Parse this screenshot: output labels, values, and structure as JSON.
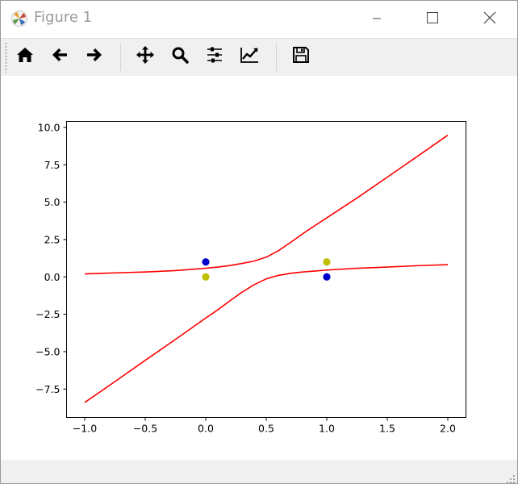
{
  "window": {
    "title": "Figure 1"
  },
  "toolbar": {
    "buttons": [
      {
        "name": "home-button",
        "icon": "home-icon"
      },
      {
        "name": "back-button",
        "icon": "arrow-left-icon"
      },
      {
        "name": "forward-button",
        "icon": "arrow-right-icon"
      },
      {
        "name": "pan-button",
        "icon": "move-icon"
      },
      {
        "name": "zoom-button",
        "icon": "magnifier-icon"
      },
      {
        "name": "subplots-button",
        "icon": "sliders-icon"
      },
      {
        "name": "axes-edit-button",
        "icon": "line-chart-icon"
      },
      {
        "name": "save-button",
        "icon": "floppy-disk-icon"
      }
    ]
  },
  "status": {
    "text": ""
  },
  "chart_data": {
    "type": "line",
    "title": "",
    "xlabel": "",
    "ylabel": "",
    "xlim": [
      -1.15,
      2.15
    ],
    "ylim": [
      -9.4,
      10.4
    ],
    "x_ticks": [
      -1.0,
      -0.5,
      0.0,
      0.5,
      1.0,
      1.5,
      2.0
    ],
    "x_tick_labels": [
      "−1.0",
      "−0.5",
      "0.0",
      "0.5",
      "1.0",
      "1.5",
      "2.0"
    ],
    "y_ticks": [
      -7.5,
      -5.0,
      -2.5,
      0.0,
      2.5,
      5.0,
      7.5,
      10.0
    ],
    "y_tick_labels": [
      "−7.5",
      "−5.0",
      "−2.5",
      "0.0",
      "2.5",
      "5.0",
      "7.5",
      "10.0"
    ],
    "grid": false,
    "series": [
      {
        "color": "#ff0000",
        "kind": "line",
        "x": [
          -1.0,
          -0.75,
          -0.5,
          -0.25,
          0.0,
          0.1,
          0.2,
          0.3,
          0.4,
          0.5,
          0.6,
          0.7,
          0.8,
          0.9,
          1.0,
          1.25,
          1.5,
          1.75,
          2.0
        ],
        "y": [
          0.2,
          0.27,
          0.33,
          0.42,
          0.58,
          0.66,
          0.76,
          0.9,
          1.06,
          1.32,
          1.75,
          2.3,
          2.88,
          3.42,
          3.95,
          5.28,
          6.67,
          8.07,
          9.48
        ]
      },
      {
        "color": "#ff0000",
        "kind": "line",
        "x": [
          -1.0,
          -0.75,
          -0.5,
          -0.25,
          0.0,
          0.1,
          0.2,
          0.3,
          0.4,
          0.5,
          0.6,
          0.7,
          0.8,
          0.9,
          1.0,
          1.25,
          1.5,
          1.75,
          2.0
        ],
        "y": [
          -8.4,
          -7.0,
          -5.58,
          -4.18,
          -2.75,
          -2.2,
          -1.6,
          -1.02,
          -0.52,
          -0.13,
          0.1,
          0.24,
          0.33,
          0.39,
          0.46,
          0.58,
          0.66,
          0.75,
          0.82
        ]
      },
      {
        "color": "#0000cc",
        "kind": "scatter",
        "x": [
          0.0,
          1.0
        ],
        "y": [
          1.0,
          0.0
        ]
      },
      {
        "color": "#bfbf00",
        "kind": "scatter",
        "x": [
          0.0,
          1.0
        ],
        "y": [
          0.0,
          1.0
        ]
      }
    ]
  }
}
